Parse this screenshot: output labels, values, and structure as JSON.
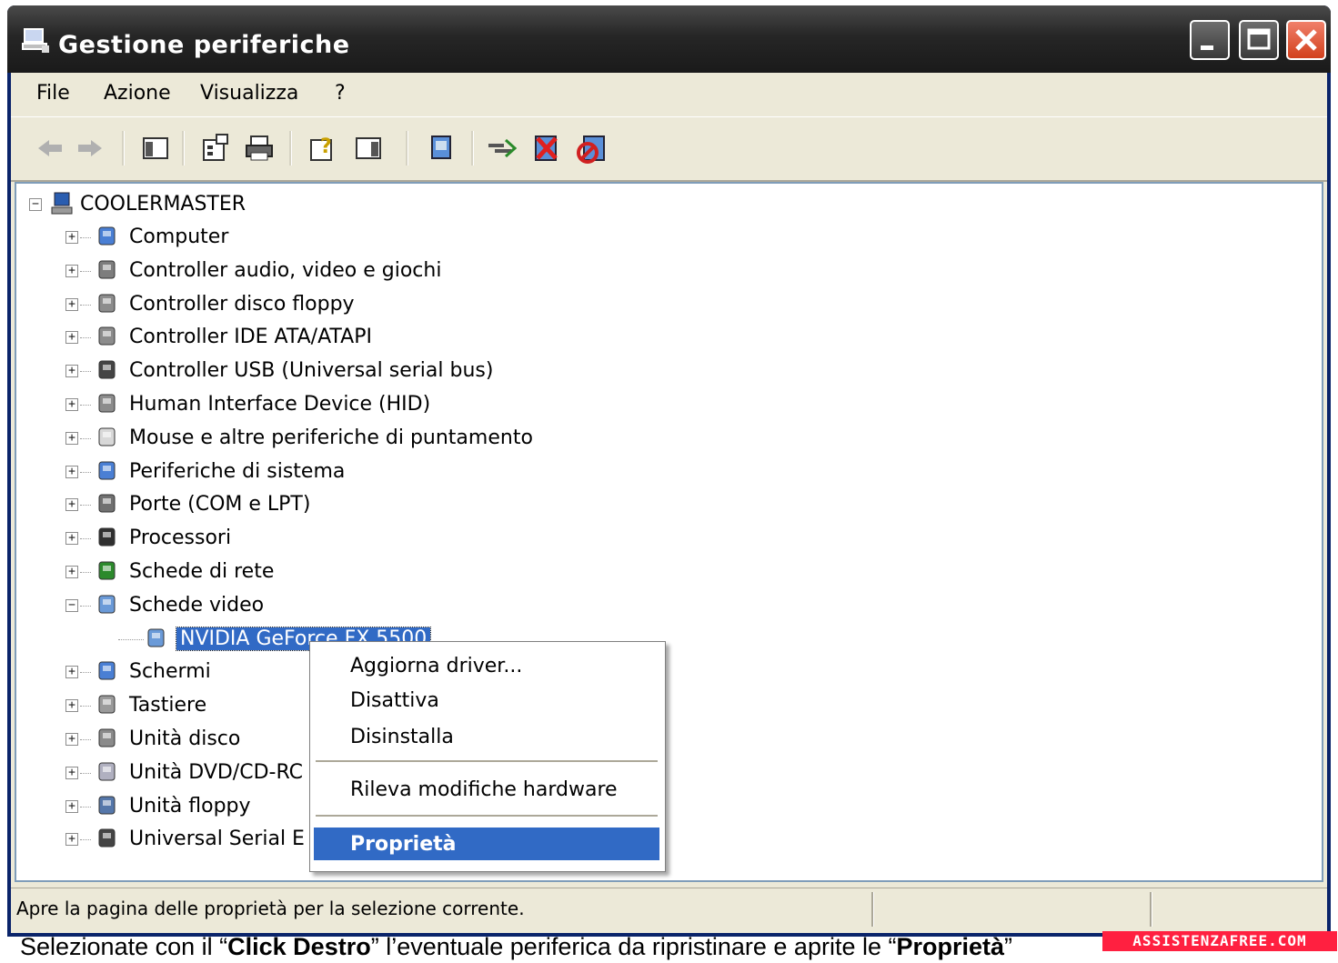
{
  "window": {
    "title": "Gestione periferiche"
  },
  "menubar": {
    "items": [
      "File",
      "Azione",
      "Visualizza",
      "?"
    ]
  },
  "toolbar": {
    "buttons": [
      "back-arrow-icon",
      "forward-arrow-icon",
      "show-hide-console-tree-icon",
      "properties-icon",
      "print-icon",
      "help-icon",
      "show-hide-action-pane-icon",
      "update-driver-icon",
      "scan-hardware-icon",
      "uninstall-icon",
      "disable-icon"
    ]
  },
  "tree": {
    "root": "COOLERMASTER",
    "categories": [
      {
        "label": "Computer",
        "icon": "computer-icon"
      },
      {
        "label": "Controller audio, video e giochi",
        "icon": "sound-icon"
      },
      {
        "label": "Controller disco floppy",
        "icon": "floppy-controller-icon"
      },
      {
        "label": "Controller IDE ATA/ATAPI",
        "icon": "ide-controller-icon"
      },
      {
        "label": "Controller USB (Universal serial bus)",
        "icon": "usb-icon"
      },
      {
        "label": "Human Interface Device (HID)",
        "icon": "hid-icon"
      },
      {
        "label": "Mouse e altre periferiche di puntamento",
        "icon": "mouse-icon"
      },
      {
        "label": "Periferiche di sistema",
        "icon": "system-device-icon"
      },
      {
        "label": "Porte (COM e LPT)",
        "icon": "port-icon"
      },
      {
        "label": "Processori",
        "icon": "processor-icon"
      },
      {
        "label": "Schede di rete",
        "icon": "network-card-icon"
      },
      {
        "label": "Schede video",
        "icon": "display-adapter-icon",
        "expanded": true
      },
      {
        "label": "Schermi",
        "icon": "monitor-icon"
      },
      {
        "label": "Tastiere",
        "icon": "keyboard-icon"
      },
      {
        "label": "Unità disco",
        "icon": "disk-drive-icon"
      },
      {
        "label": "Unità DVD/CD-RC",
        "icon": "dvd-drive-icon"
      },
      {
        "label": "Unità floppy",
        "icon": "floppy-drive-icon"
      },
      {
        "label": "Universal Serial E",
        "icon": "usb-icon"
      }
    ],
    "selected_device": "NVIDIA GeForce FX 5500"
  },
  "context_menu": {
    "update_driver": "Aggiorna driver...",
    "disable": "Disattiva",
    "uninstall": "Disinstalla",
    "scan_hardware": "Rileva modifiche hardware",
    "properties": "Proprietà"
  },
  "statusbar": {
    "text": "Apre la pagina delle proprietà per la selezione corrente."
  },
  "caption": {
    "part1": "Selezionate con il “",
    "bold1": "Click Destro",
    "part2": "” l’eventuale periferica da ripristinare e aprite le “",
    "bold2": "Proprietà",
    "part3": "”"
  },
  "watermark": "ASSISTENZAFREE.COM",
  "colors": {
    "selection": "#316ac5",
    "window_face": "#ece9d8",
    "close_button": "#d2401c"
  }
}
